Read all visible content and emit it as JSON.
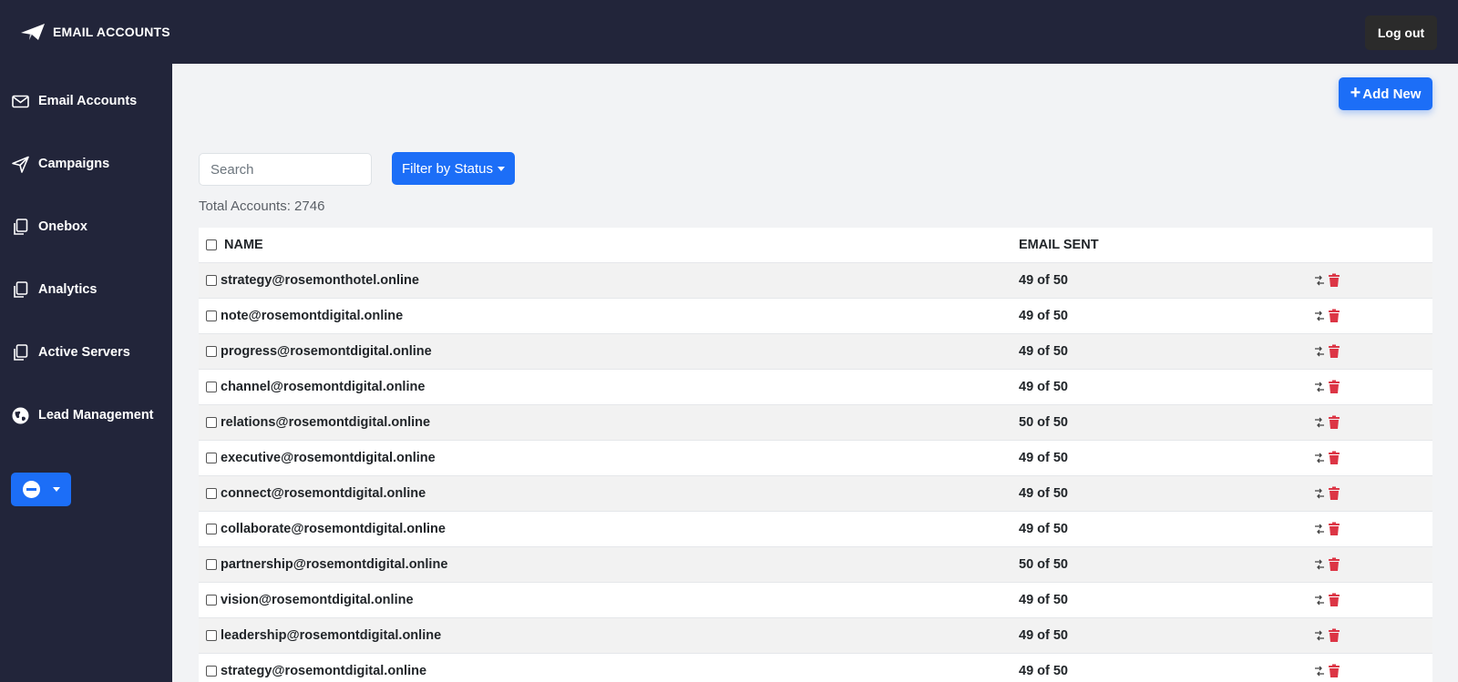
{
  "header": {
    "title": "EMAIL ACCOUNTS",
    "logout_label": "Log out"
  },
  "sidebar": {
    "items": [
      {
        "label": "Email Accounts",
        "icon": "envelope-icon"
      },
      {
        "label": "Campaigns",
        "icon": "send-icon"
      },
      {
        "label": "Onebox",
        "icon": "copy-icon"
      },
      {
        "label": "Analytics",
        "icon": "copy-icon"
      },
      {
        "label": "Active Servers",
        "icon": "copy-icon"
      },
      {
        "label": "Lead Management",
        "icon": "globe-icon"
      }
    ]
  },
  "main": {
    "add_new_label": "Add New",
    "search_placeholder": "Search",
    "filter_label": "Filter by Status",
    "total_text": "Total Accounts: 2746",
    "columns": {
      "name": "NAME",
      "sent": "EMAIL SENT"
    },
    "rows": [
      {
        "name": "strategy@rosemonthotel.online",
        "sent": "49 of 50"
      },
      {
        "name": "note@rosemontdigital.online",
        "sent": "49 of 50"
      },
      {
        "name": "progress@rosemontdigital.online",
        "sent": "49 of 50"
      },
      {
        "name": "channel@rosemontdigital.online",
        "sent": "49 of 50"
      },
      {
        "name": "relations@rosemontdigital.online",
        "sent": "50 of 50"
      },
      {
        "name": "executive@rosemontdigital.online",
        "sent": "49 of 50"
      },
      {
        "name": "connect@rosemontdigital.online",
        "sent": "49 of 50"
      },
      {
        "name": "collaborate@rosemontdigital.online",
        "sent": "49 of 50"
      },
      {
        "name": "partnership@rosemontdigital.online",
        "sent": "50 of 50"
      },
      {
        "name": "vision@rosemontdigital.online",
        "sent": "49 of 50"
      },
      {
        "name": "leadership@rosemontdigital.online",
        "sent": "49 of 50"
      },
      {
        "name": "strategy@rosemontdigital.online",
        "sent": "49 of 50"
      }
    ]
  },
  "colors": {
    "sidebar_bg": "#22253a",
    "primary": "#1c6ef7",
    "danger": "#dc3545"
  }
}
